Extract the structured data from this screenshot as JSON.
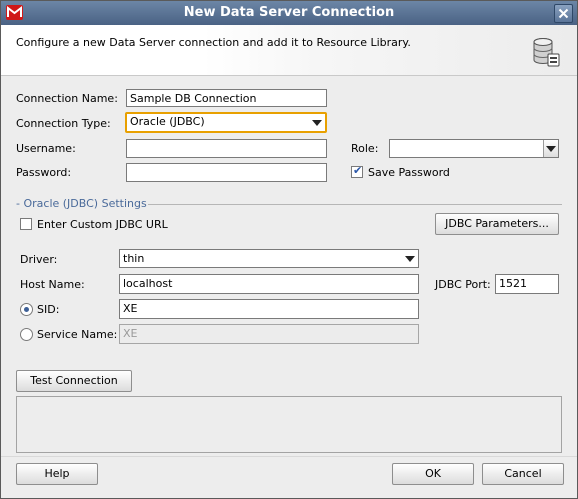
{
  "window": {
    "title": "New Data Server Connection"
  },
  "header": {
    "description": "Configure a new Data Server connection and add it to Resource Library."
  },
  "form": {
    "connection_name_label": "Connection Name:",
    "connection_name_value": "Sample DB Connection",
    "connection_type_label": "Connection Type:",
    "connection_type_value": "Oracle (JDBC)",
    "username_label": "Username:",
    "username_value": "",
    "role_label": "Role:",
    "role_value": "",
    "password_label": "Password:",
    "password_value": "",
    "save_password_label": "Save Password",
    "save_password_checked": true
  },
  "settings": {
    "section_title": "Oracle (JDBC) Settings",
    "custom_url_label": "Enter Custom JDBC URL",
    "custom_url_checked": false,
    "jdbc_params_button": "JDBC Parameters...",
    "driver_label": "Driver:",
    "driver_value": "thin",
    "host_label": "Host Name:",
    "host_value": "localhost",
    "port_label": "JDBC Port:",
    "port_value": "1521",
    "sid_label": "SID:",
    "sid_value": "XE",
    "service_label": "Service Name:",
    "service_value": "XE",
    "selected_mode": "SID"
  },
  "buttons": {
    "test_connection": "Test Connection",
    "help": "Help",
    "ok": "OK",
    "cancel": "Cancel"
  }
}
